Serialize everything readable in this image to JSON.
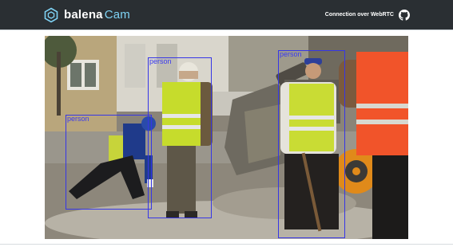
{
  "header": {
    "brand_primary": "balena",
    "brand_secondary": "Cam",
    "connection_text": "Connection over WebRTC",
    "logo_icon": "balena-cube-icon",
    "github_icon": "github-icon",
    "bar_color": "#2a2f33",
    "accent_color": "#7fd3f5"
  },
  "video": {
    "box_color": "#3636e6",
    "detections": [
      {
        "label": "person"
      },
      {
        "label": "person"
      },
      {
        "label": "person"
      }
    ]
  }
}
